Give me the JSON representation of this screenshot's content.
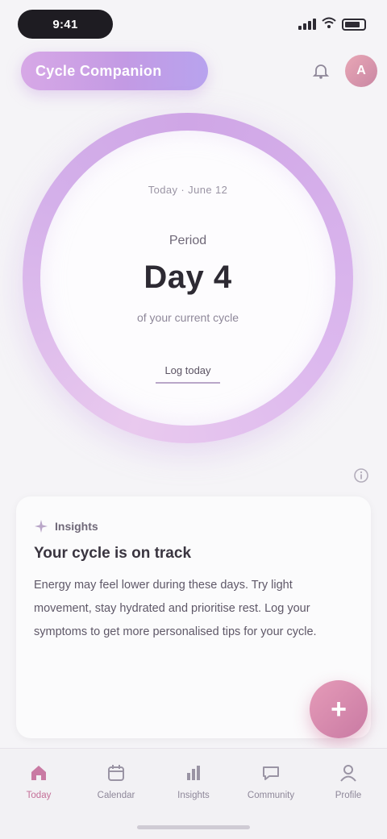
{
  "status_bar": {
    "time": "9:41"
  },
  "header": {
    "brand": "Cycle Companion",
    "avatar_initials": "A"
  },
  "ring": {
    "date_line": "Today · June 12",
    "phase_label": "Period",
    "day_value": "Day 4",
    "caption": "of your current cycle",
    "log_link": "Log today"
  },
  "insight": {
    "tag": "Insights",
    "title": "Your cycle is on track",
    "body": "Energy may feel lower during these days. Try light movement, stay hydrated and prioritise rest. Log your symptoms to get more personalised tips for your cycle."
  },
  "fab": {
    "label": "+"
  },
  "nav": {
    "items": [
      {
        "label": "Today",
        "icon": "home-icon"
      },
      {
        "label": "Calendar",
        "icon": "calendar-icon"
      },
      {
        "label": "Insights",
        "icon": "chart-icon"
      },
      {
        "label": "Community",
        "icon": "chat-icon"
      },
      {
        "label": "Profile",
        "icon": "user-icon"
      }
    ]
  },
  "colors": {
    "accent": "#c97aa3",
    "ring": "#cfa6e6",
    "brand_gradient_start": "#d7a8e6",
    "brand_gradient_end": "#b8a3ee"
  }
}
